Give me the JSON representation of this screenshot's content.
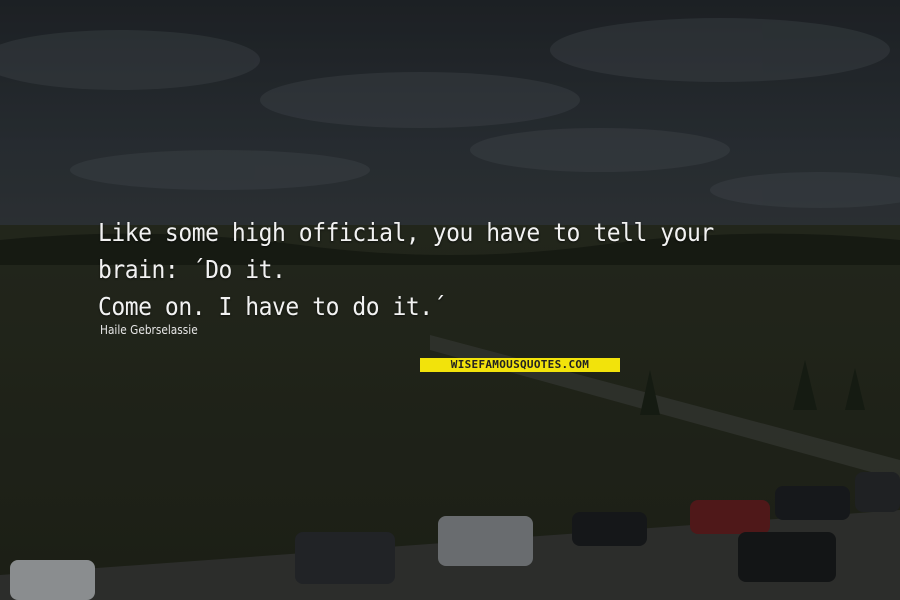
{
  "quote": {
    "line1": "Like some high official, you have to tell your brain: ´Do it.",
    "line2": "Come on. I have to do it.´",
    "author": "Haile Gebrselassie"
  },
  "brand": "WISEFAMOUSQUOTES.COM",
  "colors": {
    "sky": "#2a3036",
    "field": "#2b2f22",
    "text": "#f2f2f2",
    "brand_bg": "#f2e30b"
  }
}
